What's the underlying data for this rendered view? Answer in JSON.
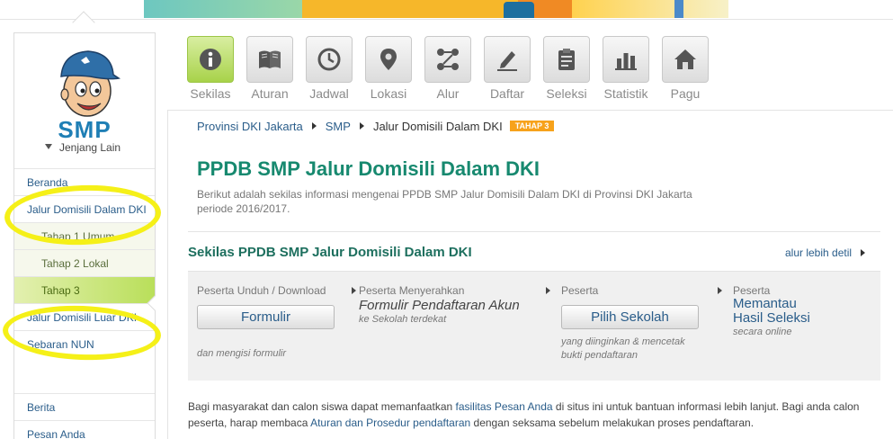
{
  "sidebar": {
    "brand": "SMP",
    "jenjang_label": "Jenjang Lain",
    "menu_top": [
      {
        "label": "Beranda"
      },
      {
        "label": "Jalur Domisili Dalam DKI"
      },
      {
        "label": "Tahap 1 Umum"
      },
      {
        "label": "Tahap 2 Lokal"
      },
      {
        "label": "Tahap 3"
      },
      {
        "label": "Jalur Domisili Luar DKI"
      },
      {
        "label": "Sebaran NUN"
      }
    ],
    "menu_bottom": [
      {
        "label": "Berita"
      },
      {
        "label": "Pesan Anda"
      }
    ]
  },
  "nav": {
    "items": [
      {
        "label": "Sekilas",
        "icon": "info-icon"
      },
      {
        "label": "Aturan",
        "icon": "book-icon"
      },
      {
        "label": "Jadwal",
        "icon": "clock-icon"
      },
      {
        "label": "Lokasi",
        "icon": "map-pin-icon"
      },
      {
        "label": "Alur",
        "icon": "flow-icon"
      },
      {
        "label": "Daftar",
        "icon": "pen-icon"
      },
      {
        "label": "Seleksi",
        "icon": "clipboard-icon"
      },
      {
        "label": "Statistik",
        "icon": "bar-chart-icon"
      },
      {
        "label": "Pagu",
        "icon": "home-icon"
      }
    ]
  },
  "breadcrumb": {
    "province": "Provinsi DKI Jakarta",
    "level": "SMP",
    "current": "Jalur Domisili Dalam DKI",
    "badge": "TAHAP 3"
  },
  "page": {
    "title": "PPDB SMP Jalur Domisili Dalam DKI",
    "description": "Berikut adalah sekilas informasi mengenai PPDB SMP Jalur Domisili Dalam DKI di Provinsi DKI Jakarta periode 2016/2017."
  },
  "section": {
    "title": "Sekilas PPDB SMP Jalur Domisili Dalam DKI",
    "link": "alur lebih detil"
  },
  "steps": {
    "s1": {
      "head": "Peserta Unduh / Download",
      "button": "Formulir",
      "note": "dan mengisi formulir"
    },
    "s2": {
      "head": "Peserta Menyerahkan",
      "emph": "Formulir Pendaftaran Akun",
      "note": "ke Sekolah terdekat"
    },
    "s3": {
      "head": "Peserta",
      "button": "Pilih Sekolah",
      "note1": "yang diinginkan & mencetak",
      "note2": "bukti pendaftaran"
    },
    "s4": {
      "head": "Peserta",
      "big1": "Memantau",
      "big2": "Hasil Seleksi",
      "note": "secara online"
    }
  },
  "footer": {
    "t1": "Bagi masyarakat dan calon siswa dapat memanfaatkan ",
    "link1": "fasilitas Pesan Anda",
    "t2": " di situs ini untuk bantuan informasi lebih lanjut. Bagi anda calon peserta, harap membaca ",
    "link2": "Aturan dan Prosedur pendaftaran",
    "t3": " dengan seksama sebelum melakukan proses pendaftaran."
  },
  "colors": {
    "accent_green": "#17896f",
    "link_blue": "#2a5d8a",
    "active_menu": "#b9df5a",
    "badge_orange": "#f7a21b",
    "highlight_yellow": "#f5f018"
  }
}
